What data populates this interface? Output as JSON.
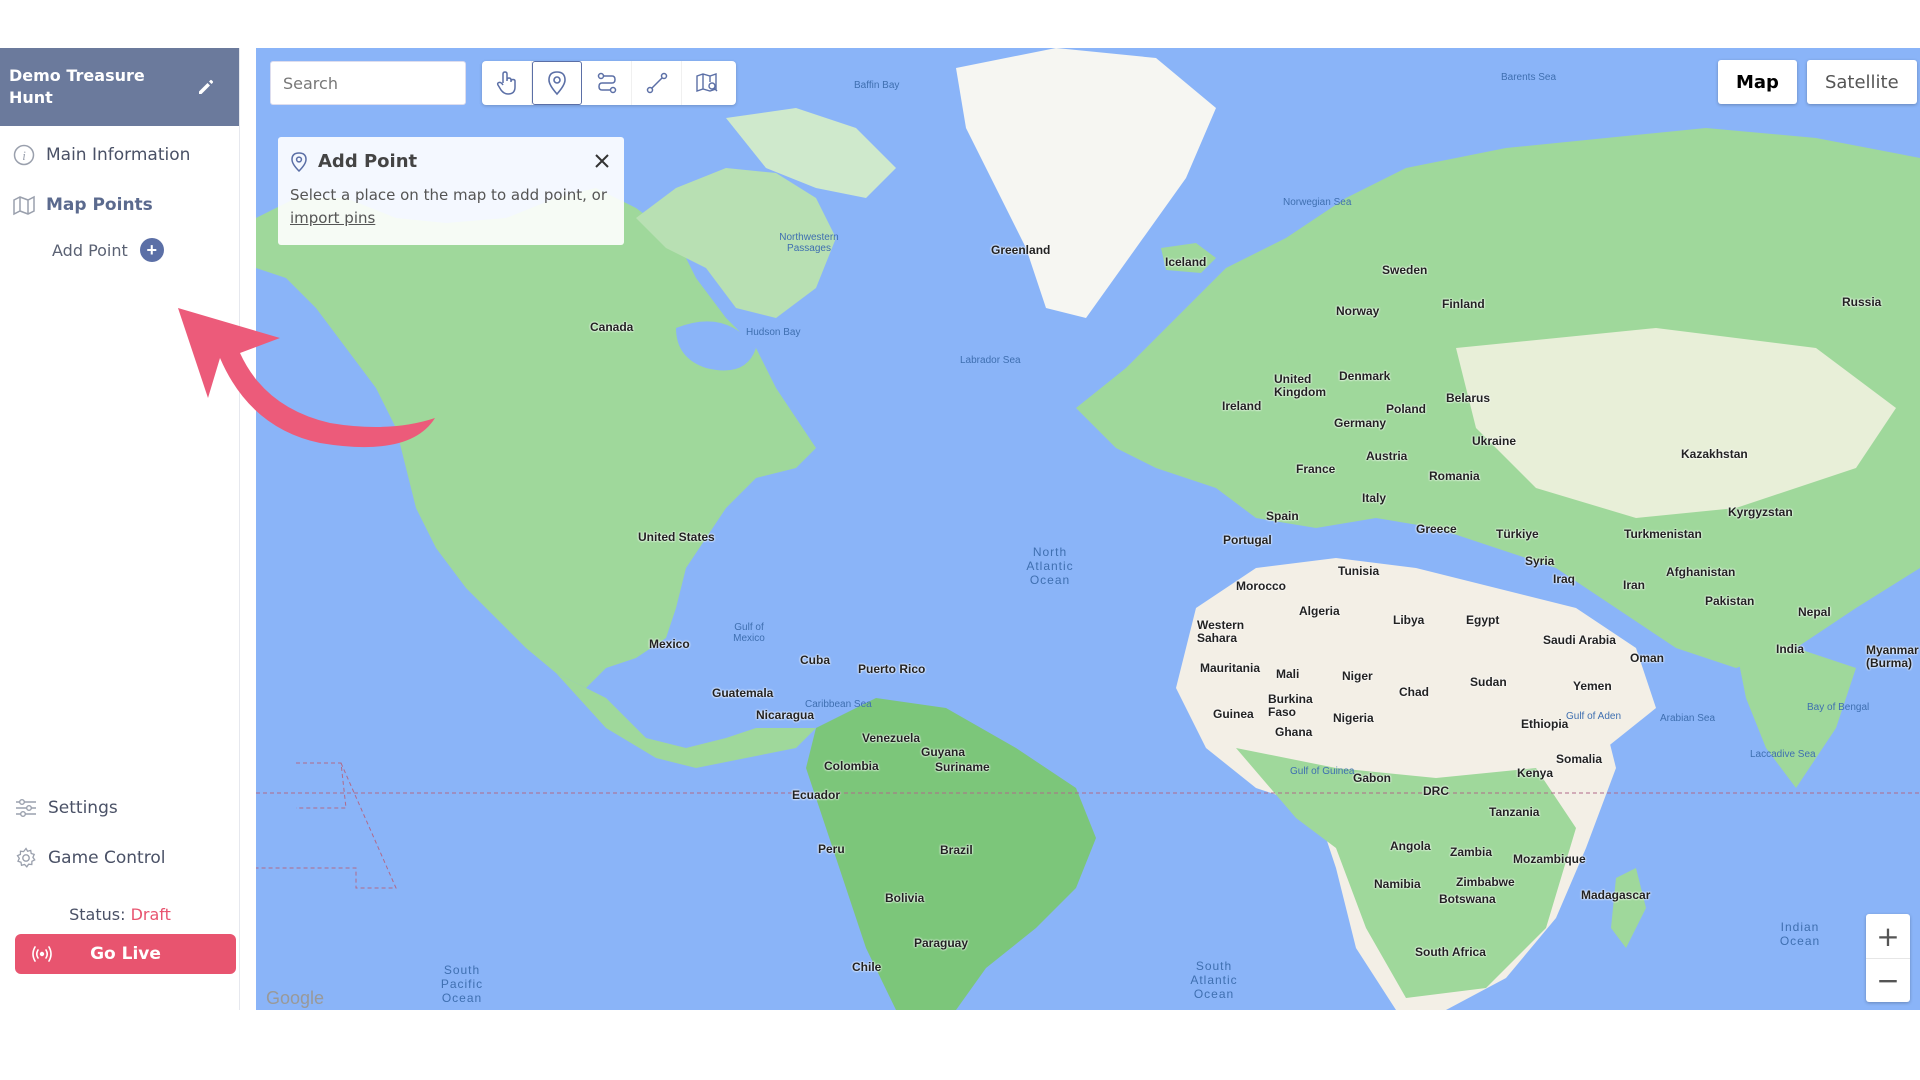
{
  "project": {
    "title": "Demo Treasure Hunt"
  },
  "nav": {
    "main_info": "Main Information",
    "map_points": "Map Points",
    "add_point": "Add Point",
    "settings": "Settings",
    "game_control": "Game Control"
  },
  "status": {
    "label": "Status:",
    "value": "Draft"
  },
  "golive": {
    "label": "Go Live"
  },
  "search": {
    "placeholder": "Search"
  },
  "toolbar": {
    "tools": [
      "hand-tool",
      "pin-tool",
      "route-tool",
      "path-tool",
      "map-tool"
    ]
  },
  "add_panel": {
    "title": "Add Point",
    "text": "Select a place on the map to add point, or",
    "link": "import pins"
  },
  "map_type": {
    "map": "Map",
    "satellite": "Satellite"
  },
  "zoom": {
    "in": "+",
    "out": "−"
  },
  "map_labels": {
    "greenland": "Greenland",
    "iceland": "Iceland",
    "canada": "Canada",
    "united_states": "United States",
    "mexico": "Mexico",
    "cuba": "Cuba",
    "puerto_rico": "Puerto Rico",
    "guatemala": "Guatemala",
    "nicaragua": "Nicaragua",
    "venezuela": "Venezuela",
    "guyana": "Guyana",
    "suriname": "Suriname",
    "colombia": "Colombia",
    "ecuador": "Ecuador",
    "peru": "Peru",
    "brazil": "Brazil",
    "bolivia": "Bolivia",
    "paraguay": "Paraguay",
    "chile": "Chile",
    "norway": "Norway",
    "sweden": "Sweden",
    "finland": "Finland",
    "russia": "Russia",
    "uk": "United Kingdom",
    "ireland": "Ireland",
    "denmark": "Denmark",
    "poland": "Poland",
    "belarus": "Belarus",
    "germany": "Germany",
    "ukraine": "Ukraine",
    "austria": "Austria",
    "france": "France",
    "romania": "Romania",
    "italy": "Italy",
    "spain": "Spain",
    "portugal": "Portugal",
    "greece": "Greece",
    "turkiye": "Türkiye",
    "syria": "Syria",
    "iraq": "Iraq",
    "iran": "Iran",
    "kazakhstan": "Kazakhstan",
    "kyrgyzstan": "Kyrgyzstan",
    "turkmenistan": "Turkmenistan",
    "afghanistan": "Afghanistan",
    "pakistan": "Pakistan",
    "nepal": "Nepal",
    "india": "India",
    "myanmar": "Myanmar (Burma)",
    "morocco": "Morocco",
    "tunisia": "Tunisia",
    "algeria": "Algeria",
    "libya": "Libya",
    "egypt": "Egypt",
    "western_sahara": "Western Sahara",
    "mauritania": "Mauritania",
    "mali": "Mali",
    "niger": "Niger",
    "chad": "Chad",
    "sudan": "Sudan",
    "saudi_arabia": "Saudi Arabia",
    "oman": "Oman",
    "yemen": "Yemen",
    "guinea": "Guinea",
    "burkina_faso": "Burkina Faso",
    "ghana": "Ghana",
    "nigeria": "Nigeria",
    "ethiopia": "Ethiopia",
    "somalia": "Somalia",
    "kenya": "Kenya",
    "gabon": "Gabon",
    "drc": "DRC",
    "tanzania": "Tanzania",
    "angola": "Angola",
    "zambia": "Zambia",
    "mozambique": "Mozambique",
    "namibia": "Namibia",
    "zimbabwe": "Zimbabwe",
    "botswana": "Botswana",
    "madagascar": "Madagascar",
    "south_africa": "South Africa",
    "north_atlantic": "North Atlantic Ocean",
    "south_atlantic": "South Atlantic Ocean",
    "south_pacific": "South Pacific Ocean",
    "indian_ocean": "Indian Ocean",
    "baffin_bay": "Baffin Bay",
    "barents_sea": "Barents Sea",
    "norwegian_sea": "Norwegian Sea",
    "hudson_bay": "Hudson Bay",
    "labrador_sea": "Labrador Sea",
    "nw_passages": "Northwestern Passages",
    "gulf_mexico": "Gulf of Mexico",
    "caribbean": "Caribbean Sea",
    "arabian_sea": "Arabian Sea",
    "bay_bengal": "Bay of Bengal",
    "gulf_aden": "Gulf of Aden",
    "gulf_guinea": "Gulf of Guinea",
    "laccadive": "Laccadive Sea",
    "google": "Google"
  },
  "colors": {
    "accent": "#5b6fa6",
    "header": "#6b7a9c",
    "golive": "#e8546f",
    "ocean": "#8ab4f8",
    "land": "#9fd89b",
    "desert": "#f3efe6"
  }
}
